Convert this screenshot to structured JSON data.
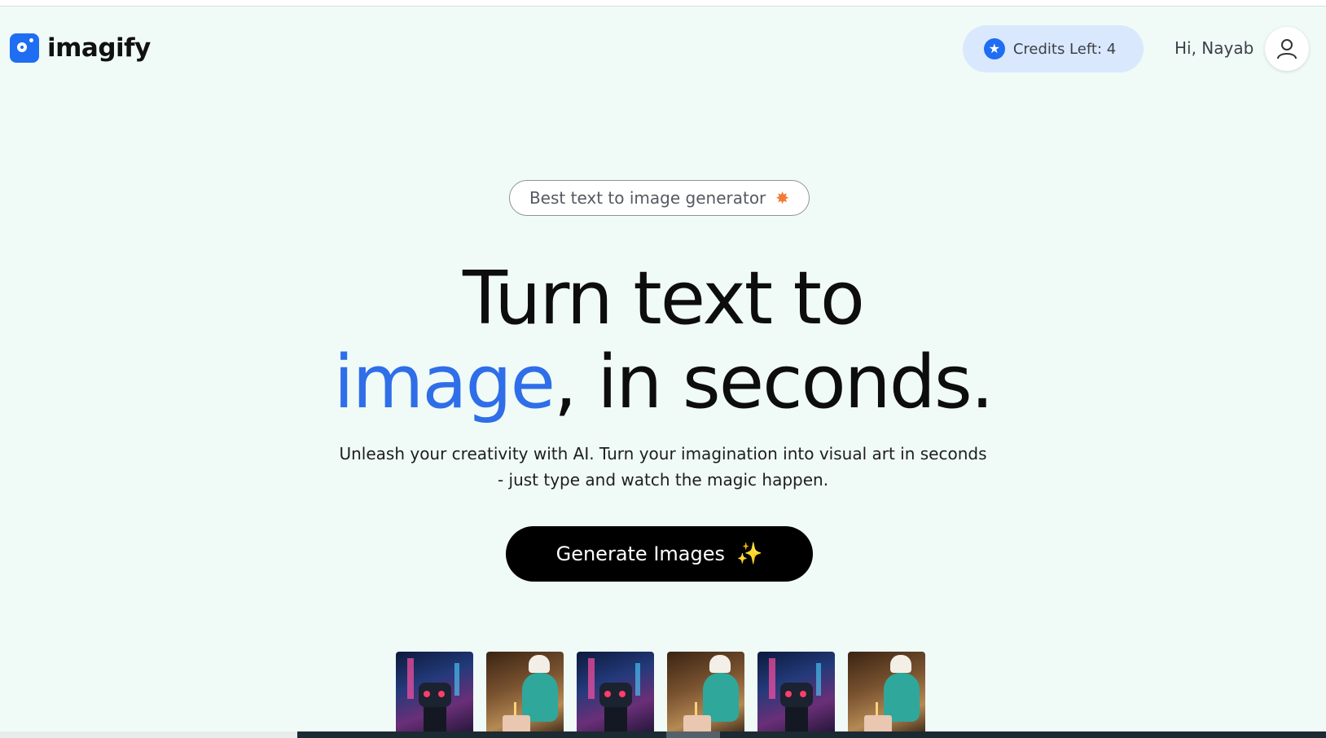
{
  "header": {
    "logo_text": "imagify",
    "credits_label": "Credits Left: 4",
    "greeting": "Hi, Nayab"
  },
  "hero": {
    "badge_text": "Best text to image generator",
    "headline_line1": "Turn text to",
    "headline_accent": "image",
    "headline_rest": ", in seconds.",
    "subtitle": "Unleash your creativity with AI. Turn your imagination into visual art in seconds - just type and watch the magic happen.",
    "cta_label": "Generate Images"
  },
  "gallery": {
    "thumbnails": [
      "robot",
      "monster",
      "robot",
      "monster",
      "robot",
      "monster"
    ]
  },
  "colors": {
    "accent": "#2f6ee8",
    "background": "#f0fbf8",
    "credits_bg": "#d9e8fd",
    "cta_bg": "#000000"
  },
  "icons": {
    "logo": "imagify-logo-icon",
    "credits": "star-icon",
    "avatar": "user-icon",
    "badge": "star-burst-icon",
    "cta": "sparkles-icon"
  }
}
